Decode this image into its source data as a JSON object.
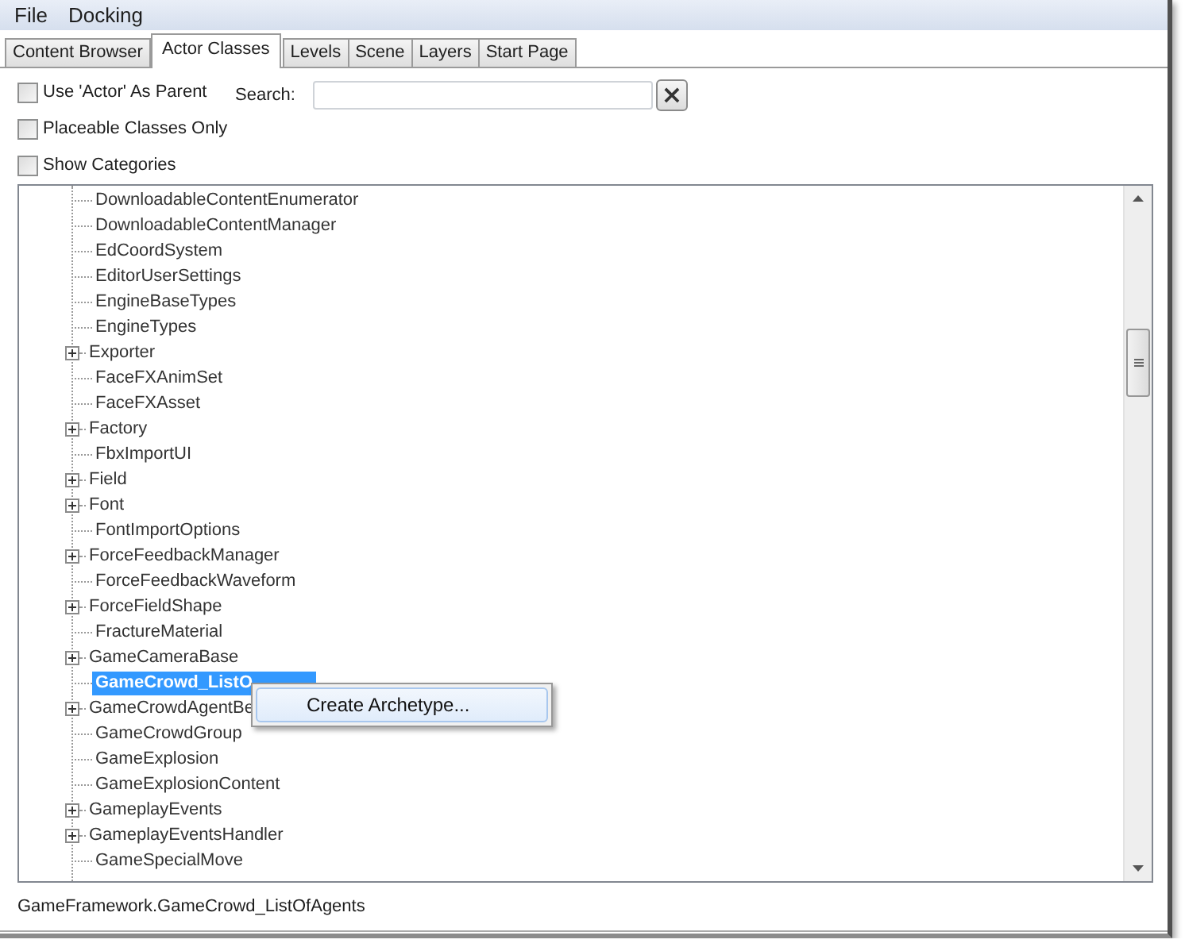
{
  "menu_bar": [
    "File",
    "Docking"
  ],
  "tabs": [
    {
      "label": "Content Browser",
      "selected": false
    },
    {
      "label": "Actor Classes",
      "selected": true
    },
    {
      "label": "Levels",
      "selected": false
    },
    {
      "label": "Scene",
      "selected": false
    },
    {
      "label": "Layers",
      "selected": false
    },
    {
      "label": "Start Page",
      "selected": false
    }
  ],
  "options": [
    {
      "label": "Use 'Actor' As Parent",
      "checked": false
    },
    {
      "label": "Placeable Classes Only",
      "checked": false
    },
    {
      "label": "Show Categories",
      "checked": false
    }
  ],
  "search": {
    "label": "Search:",
    "clear_button": "×"
  },
  "tree": [
    {
      "label": "DownloadableContentEnumerator",
      "expandable": false,
      "selected": false
    },
    {
      "label": "DownloadableContentManager",
      "expandable": false,
      "selected": false
    },
    {
      "label": "EdCoordSystem",
      "expandable": false,
      "selected": false
    },
    {
      "label": "EditorUserSettings",
      "expandable": false,
      "selected": false
    },
    {
      "label": "EngineBaseTypes",
      "expandable": false,
      "selected": false
    },
    {
      "label": "EngineTypes",
      "expandable": false,
      "selected": false
    },
    {
      "label": "Exporter",
      "expandable": true,
      "selected": false
    },
    {
      "label": "FaceFXAnimSet",
      "expandable": false,
      "selected": false
    },
    {
      "label": "FaceFXAsset",
      "expandable": false,
      "selected": false
    },
    {
      "label": "Factory",
      "expandable": true,
      "selected": false
    },
    {
      "label": "FbxImportUI",
      "expandable": false,
      "selected": false
    },
    {
      "label": "Field",
      "expandable": true,
      "selected": false
    },
    {
      "label": "Font",
      "expandable": true,
      "selected": false
    },
    {
      "label": "FontImportOptions",
      "expandable": false,
      "selected": false
    },
    {
      "label": "ForceFeedbackManager",
      "expandable": true,
      "selected": false
    },
    {
      "label": "ForceFeedbackWaveform",
      "expandable": false,
      "selected": false
    },
    {
      "label": "ForceFieldShape",
      "expandable": true,
      "selected": false
    },
    {
      "label": "FractureMaterial",
      "expandable": false,
      "selected": false
    },
    {
      "label": "GameCameraBase",
      "expandable": true,
      "selected": false
    },
    {
      "label": "GameCrowd_ListO",
      "expandable": false,
      "selected": true
    },
    {
      "label": "GameCrowdAgentBe",
      "expandable": true,
      "selected": false
    },
    {
      "label": "GameCrowdGroup",
      "expandable": false,
      "selected": false
    },
    {
      "label": "GameExplosion",
      "expandable": false,
      "selected": false
    },
    {
      "label": "GameExplosionContent",
      "expandable": false,
      "selected": false
    },
    {
      "label": "GameplayEvents",
      "expandable": true,
      "selected": false
    },
    {
      "label": "GameplayEventsHandler",
      "expandable": true,
      "selected": false
    },
    {
      "label": "GameSpecialMove",
      "expandable": false,
      "selected": false
    }
  ],
  "context_menu": {
    "items": [
      "Create Archetype..."
    ]
  },
  "status_bar": "GameFramework.GameCrowd_ListOfAgents"
}
